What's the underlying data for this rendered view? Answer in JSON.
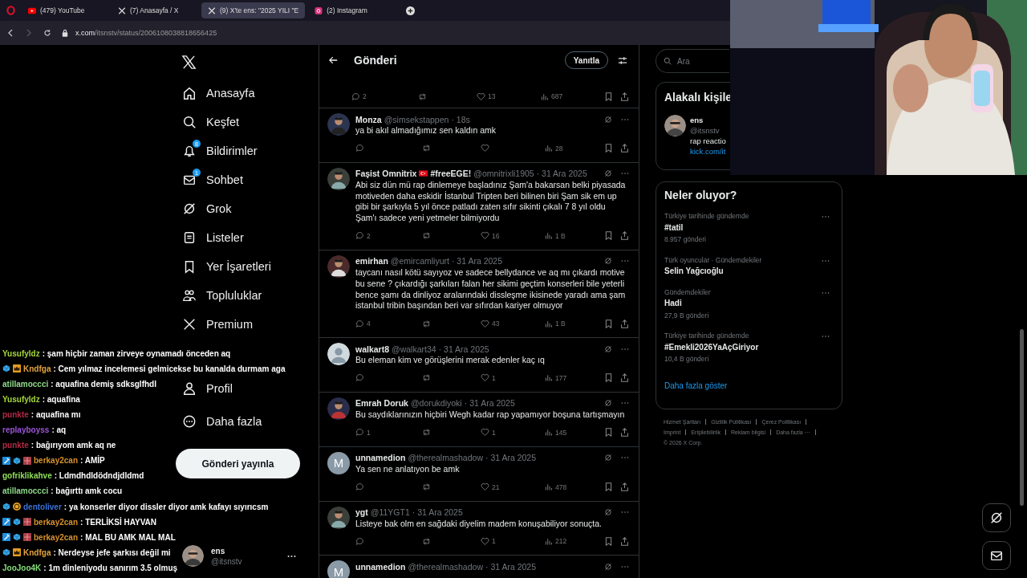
{
  "browser": {
    "tabs": [
      {
        "title": "(479) YouTube",
        "kind": "youtube",
        "selected": false
      },
      {
        "title": "(7) Anasayfa / X",
        "kind": "x",
        "selected": false
      },
      {
        "title": "(9) X'te ens: \"2025 YILI \"E",
        "kind": "x",
        "selected": true
      },
      {
        "title": "(2) Instagram",
        "kind": "instagram",
        "selected": false
      }
    ],
    "url_host": "x.com",
    "url_path": "/itsnstv/status/2006108038818656425"
  },
  "nav": {
    "items": [
      {
        "label": "Anasayfa",
        "kind": "home"
      },
      {
        "label": "Keşfet",
        "kind": "search"
      },
      {
        "label": "Bildirimler",
        "kind": "bell",
        "badge": "8"
      },
      {
        "label": "Sohbet",
        "kind": "mail",
        "badge": "1"
      },
      {
        "label": "Grok",
        "kind": "grok"
      },
      {
        "label": "Listeler",
        "kind": "list"
      },
      {
        "label": "Yer İşaretleri",
        "kind": "bookmark"
      },
      {
        "label": "Topluluklar",
        "kind": "people"
      },
      {
        "label": "Premium",
        "kind": "x"
      },
      {
        "label": "Profil",
        "kind": "person"
      },
      {
        "label": "Daha fazla",
        "kind": "more"
      }
    ],
    "post_button": "Gönderi yayınla",
    "account": {
      "name": "ens",
      "handle": "@itsnstv"
    }
  },
  "thread": {
    "title": "Gönderi",
    "reply_button": "Yanıtla",
    "partial_actions": {
      "replies": "2",
      "likes": "13",
      "views": "687"
    },
    "replies": [
      {
        "name": "Monza",
        "handle": "@simsekstappen",
        "time": "· 18s",
        "text": "ya bi akıl almadığımız sen kaldın amk",
        "views": "28"
      },
      {
        "name": "Faşist Omnitrix",
        "flag": true,
        "tag": "#freeEGE!",
        "handle": "@omnitrixli1905",
        "time": "· 31 Ara 2025",
        "text": "Abi siz dün mü rap dinlemeye başladınız Şam'a bakarsan belki piyasada motiveden daha eskidir İstanbul Tripten beri bilinen biri Şam sik em up gibi bir şarkıyla 5 yıl önce patladı zaten sıfır sikinti çıkalı 7 8 yıl oldu Şam'ı sadece yeni yetmeler bilmiyordu",
        "replies": "2",
        "likes": "16",
        "views": "1 B"
      },
      {
        "name": "emirhan",
        "handle": "@emircamliyurt",
        "time": "· 31 Ara 2025",
        "text": "taycanı nasıl kötü sayıyoz ve sadece bellydance ve aq mı çıkardı motive bu sene ? çıkardığı şarkıları falan her sikimi geçtim konserleri bile yeterli bence şamı da dinliyoz aralarındaki dissleşme ikisinede yaradı ama şam istanbul tribin başından beri var sıfırdan kariyer olmuyor",
        "replies": "4",
        "likes": "43",
        "views": "1 B"
      },
      {
        "name": "walkart8",
        "handle": "@walkart34",
        "time": "· 31 Ara 2025",
        "kind": "default",
        "text": "Bu eleman kim ve görüşlerini merak edenler kaç ıq",
        "likes": "1",
        "views": "177"
      },
      {
        "name": "Emrah Doruk",
        "handle": "@dorukdiyoki",
        "time": "· 31 Ara 2025",
        "text": "Bu saydıklarınızın hiçbiri Wegh kadar rap yapamıyor boşuna tartışmayın",
        "replies": "1",
        "likes": "1",
        "views": "145"
      },
      {
        "name": "unnamedion",
        "handle": "@therealmashadow",
        "time": "· 31 Ara 2025",
        "kind": "letter",
        "letter": "M",
        "text": "Ya sen ne anlatıyon be amk",
        "likes": "21",
        "views": "478"
      },
      {
        "name": "ygt",
        "handle": "@11YGT1",
        "time": "· 31 Ara 2025",
        "text": "Listeye bak olm en sağdaki diyelim madem konuşabiliyor sonuçta.",
        "likes": "1",
        "views": "212"
      },
      {
        "name": "unnamedion",
        "handle": "@therealmashadow",
        "time": "· 31 Ara 2025",
        "kind": "letter",
        "letter": "M"
      }
    ]
  },
  "sidebar": {
    "search_placeholder": "Ara",
    "related": {
      "title": "Alakalı kişile",
      "name": "ens",
      "handle": "@itsnstv",
      "bio": "rap reactio",
      "link": "kick.com/it"
    },
    "trends": {
      "title": "Neler oluyor?",
      "items": [
        {
          "category": "Türkiye tarihinde gündemde",
          "topic": "#tatil",
          "count": "8.957 gönderi"
        },
        {
          "category": "Türk oyuncular · Gündemdekiler",
          "topic": "Selin Yağcıoğlu"
        },
        {
          "category": "Gündemdekiler",
          "topic": "Hadi",
          "count": "27,9 B gönderi"
        },
        {
          "category": "Türkiye tarihinde gündemde",
          "topic": "#Emekli2026YaAçGiriyor",
          "count": "10,4 B gönderi"
        }
      ],
      "more": "Daha fazla göster"
    },
    "footer_links": [
      "Hizmet Şartları",
      "Gizlilik Politikası",
      "Çerez Politikası",
      "Imprint",
      "Erişilebilirlik",
      "Reklam bilgisi",
      "Daha fazla ···"
    ],
    "copyright": "© 2026 X Corp."
  },
  "chat": [
    {
      "user": "Yusufyldz",
      "color": "#a4d63a",
      "message": ": şam hiçbir zaman zirveye oynamadı önceden aq"
    },
    {
      "user": "Kndfga",
      "color": "#e3a33c",
      "badges": [
        {
          "kind": "cube"
        },
        {
          "kind": "crown"
        }
      ],
      "message": ": Cem yılmaz incelemesi gelmicekse bu kanalda durmam aga"
    },
    {
      "user": "atillamoccci",
      "color": "#8fd88a",
      "message": ": aquafina demiş sdksglfhdl"
    },
    {
      "user": "Yusufyldz",
      "color": "#a4d63a",
      "message": ": aquafina"
    },
    {
      "user": "punkte",
      "color": "#b32a46",
      "message": ": aquafina mı"
    },
    {
      "user": "replayboyss",
      "color": "#9b55d8",
      "message": ": aq"
    },
    {
      "user": "punkte",
      "color": "#b32a46",
      "message": ": bağırıyom amk aq ne"
    },
    {
      "user": "berkay2can",
      "color": "#d8922e",
      "badges": [
        {
          "kind": "sword"
        },
        {
          "kind": "cube"
        },
        {
          "kind": "gift"
        }
      ],
      "message": ": AMİP"
    },
    {
      "user": "gofriklikahve",
      "color": "#8fe05a",
      "message": ": Ldmdhdldödndjdldmd"
    },
    {
      "user": "atillamoccci",
      "color": "#8fd88a",
      "message": ": bağırttı amk cocu"
    },
    {
      "user": "dentoliver",
      "color": "#3a72d8",
      "badges": [
        {
          "kind": "cube"
        },
        {
          "kind": "coin"
        }
      ],
      "message": ": ya konserler diyor dissler diyor amk kafayı sıyırıcsm"
    },
    {
      "user": "berkay2can",
      "color": "#d8922e",
      "badges": [
        {
          "kind": "sword"
        },
        {
          "kind": "cube"
        },
        {
          "kind": "gift"
        }
      ],
      "message": ": TERLİKSİ HAYVAN"
    },
    {
      "user": "berkay2can",
      "color": "#d8922e",
      "badges": [
        {
          "kind": "sword"
        },
        {
          "kind": "cube"
        },
        {
          "kind": "gift"
        }
      ],
      "message": ": MAL BU AMK MAL MAL"
    },
    {
      "user": "Kndfga",
      "color": "#e3a33c",
      "badges": [
        {
          "kind": "cube"
        },
        {
          "kind": "crown"
        }
      ],
      "message": ": Nerdeyse jefe şarkısı değil mi"
    },
    {
      "user": "JooJoo4K",
      "color": "#86dc7a",
      "message": ": 1m dinleniyodu sanırım 3.5 olmuş"
    }
  ]
}
